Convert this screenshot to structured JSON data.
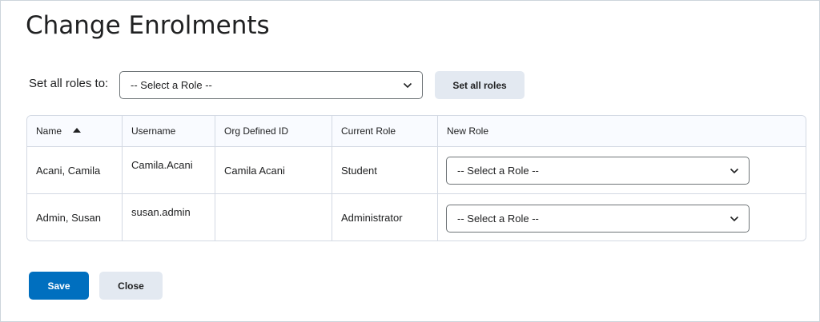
{
  "page": {
    "title": "Change Enrolments"
  },
  "set_all": {
    "label": "Set all roles to:",
    "select_value": "-- Select a Role --",
    "button_label": "Set all roles"
  },
  "table": {
    "headers": [
      "Name",
      "Username",
      "Org Defined ID",
      "Current Role",
      "New Role"
    ],
    "sort_icon": "sort-ascending-icon",
    "rows": [
      {
        "name": "Acani, Camila",
        "username": "Camila.Acani",
        "org_id": "Camila Acani",
        "current_role": "Student",
        "new_role": "-- Select a Role --"
      },
      {
        "name": "Admin, Susan",
        "username": "susan.admin",
        "org_id": "",
        "current_role": "Administrator",
        "new_role": "-- Select a Role --"
      }
    ]
  },
  "actions": {
    "save_label": "Save",
    "close_label": "Close"
  },
  "colors": {
    "primary": "#006fbf",
    "secondary": "#e3e9f1",
    "border": "#d3d9e3"
  }
}
